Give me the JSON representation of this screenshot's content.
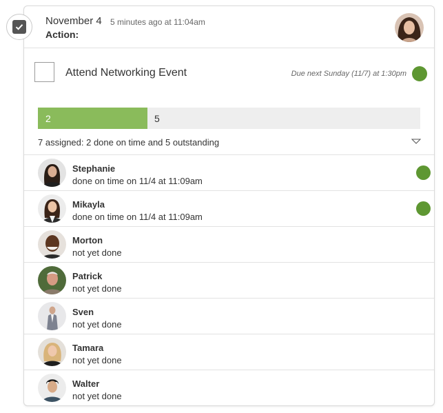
{
  "header": {
    "date": "November 4",
    "time_ago": "5 minutes ago at 11:04am",
    "action_label": "Action:",
    "owner_avatar": "avatar-photo-woman-dark-hair"
  },
  "task": {
    "title": "Attend Networking Event",
    "due": "Due next Sunday (11/7) at 1:30pm",
    "status_color": "#5e9732"
  },
  "progress": {
    "done": 2,
    "outstanding": 5,
    "total": 7,
    "done_label": "2",
    "outstanding_label": "5",
    "done_color": "#8abb5b",
    "track_color": "#eeeeee"
  },
  "summary": "7 assigned: 2 done on time and 5 outstanding",
  "assignees": [
    {
      "name": "Stephanie",
      "status": "done on time on 11/4 at 11:09am",
      "done": true
    },
    {
      "name": "Mikayla",
      "status": "done on time on 11/4 at 11:09am",
      "done": true
    },
    {
      "name": "Morton",
      "status": "not yet done",
      "done": false
    },
    {
      "name": "Patrick",
      "status": "not yet done",
      "done": false
    },
    {
      "name": "Sven",
      "status": "not yet done",
      "done": false
    },
    {
      "name": "Tamara",
      "status": "not yet done",
      "done": false
    },
    {
      "name": "Walter",
      "status": "not yet done",
      "done": false
    }
  ],
  "icons": {
    "badge": "checkbox-checked-icon",
    "expand": "chevron-down-icon"
  }
}
